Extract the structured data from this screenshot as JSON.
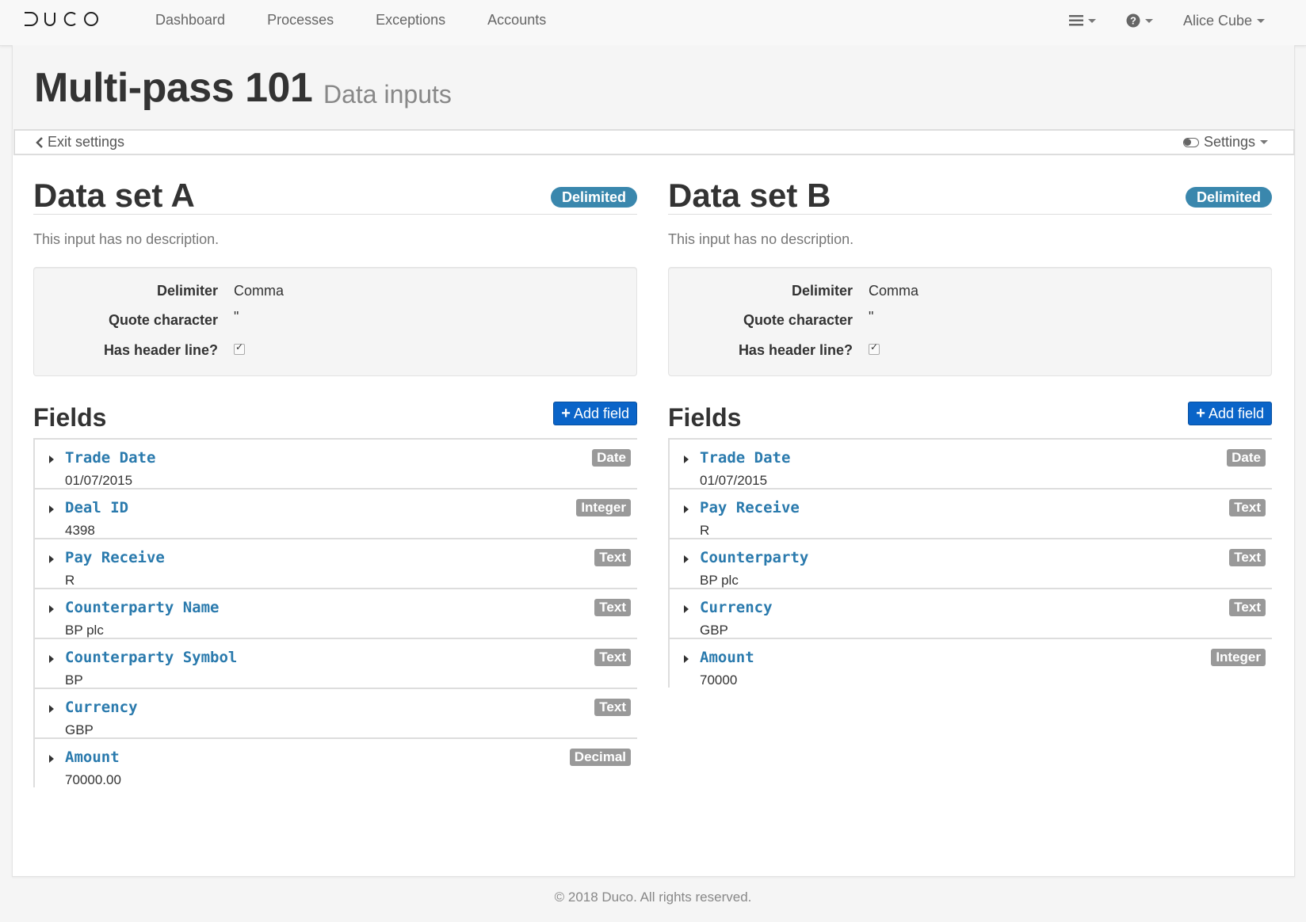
{
  "nav": {
    "brand": "DUCO",
    "links": [
      "Dashboard",
      "Processes",
      "Exceptions",
      "Accounts"
    ],
    "menu_icon": "hamburger-icon",
    "help_icon": "question-icon",
    "user": "Alice Cube"
  },
  "header": {
    "title": "Multi-pass 101",
    "subtitle": "Data inputs"
  },
  "toolbar": {
    "exit_label": "Exit settings",
    "settings_label": "Settings"
  },
  "colors": {
    "badge_delimited": "#3a87ad",
    "add_button": "#0a64c8",
    "field_name": "#2a7aad",
    "type_badge": "#999999"
  },
  "datasets": [
    {
      "title": "Data set A",
      "format": "Delimited",
      "description": "This input has no description.",
      "props": {
        "delimiter_label": "Delimiter",
        "delimiter_value": "Comma",
        "quote_label": "Quote character",
        "quote_value": "\"",
        "header_label": "Has header line?",
        "header_checked": true
      },
      "fields_title": "Fields",
      "add_field_label": "Add field",
      "fields": [
        {
          "name": "Trade Date",
          "sample": "01/07/2015",
          "type": "Date"
        },
        {
          "name": "Deal ID",
          "sample": "4398",
          "type": "Integer"
        },
        {
          "name": "Pay Receive",
          "sample": "R",
          "type": "Text"
        },
        {
          "name": "Counterparty Name",
          "sample": "BP plc",
          "type": "Text"
        },
        {
          "name": "Counterparty Symbol",
          "sample": "BP",
          "type": "Text"
        },
        {
          "name": "Currency",
          "sample": "GBP",
          "type": "Text"
        },
        {
          "name": "Amount",
          "sample": "70000.00",
          "type": "Decimal"
        }
      ]
    },
    {
      "title": "Data set B",
      "format": "Delimited",
      "description": "This input has no description.",
      "props": {
        "delimiter_label": "Delimiter",
        "delimiter_value": "Comma",
        "quote_label": "Quote character",
        "quote_value": "\"",
        "header_label": "Has header line?",
        "header_checked": true
      },
      "fields_title": "Fields",
      "add_field_label": "Add field",
      "fields": [
        {
          "name": "Trade Date",
          "sample": "01/07/2015",
          "type": "Date"
        },
        {
          "name": "Pay Receive",
          "sample": "R",
          "type": "Text"
        },
        {
          "name": "Counterparty",
          "sample": "BP plc",
          "type": "Text"
        },
        {
          "name": "Currency",
          "sample": "GBP",
          "type": "Text"
        },
        {
          "name": "Amount",
          "sample": "70000",
          "type": "Integer"
        }
      ]
    }
  ],
  "footer": "© 2018 Duco. All rights reserved."
}
